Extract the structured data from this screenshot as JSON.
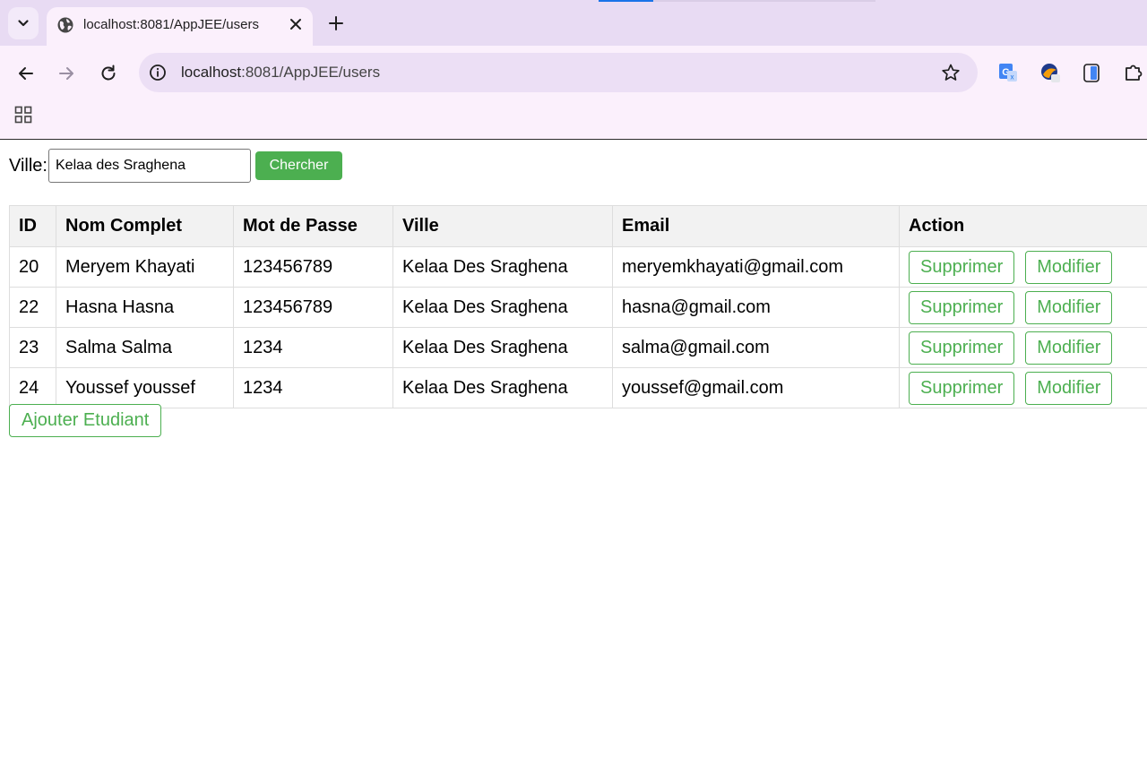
{
  "browser": {
    "tab_title": "localhost:8081/AppJEE/users",
    "url_host": "localhost",
    "url_path": ":8081/AppJEE/users"
  },
  "search": {
    "label": "Ville:",
    "value": "Kelaa des Sraghena",
    "button_label": "Chercher"
  },
  "table": {
    "headers": {
      "id": "ID",
      "nom": "Nom Complet",
      "mdp": "Mot de Passe",
      "ville": "Ville",
      "email": "Email",
      "action": "Action"
    },
    "rows": [
      {
        "id": "20",
        "nom": "Meryem Khayati",
        "mdp": "123456789",
        "ville": "Kelaa Des Sraghena",
        "email": "meryemkhayati@gmail.com",
        "delete_label": "Supprimer",
        "edit_label": "Modifier"
      },
      {
        "id": "22",
        "nom": "Hasna Hasna",
        "mdp": "123456789",
        "ville": "Kelaa Des Sraghena",
        "email": "hasna@gmail.com",
        "delete_label": "Supprimer",
        "edit_label": "Modifier"
      },
      {
        "id": "23",
        "nom": "Salma Salma",
        "mdp": "1234",
        "ville": "Kelaa Des Sraghena",
        "email": "salma@gmail.com",
        "delete_label": "Supprimer",
        "edit_label": "Modifier"
      },
      {
        "id": "24",
        "nom": "Youssef youssef",
        "mdp": "1234",
        "ville": "Kelaa Des Sraghena",
        "email": "youssef@gmail.com",
        "delete_label": "Supprimer",
        "edit_label": "Modifier"
      }
    ]
  },
  "add_button_label": "Ajouter Etudiant",
  "colors": {
    "accent": "#4caf50",
    "chrome_bg": "#fbf0fc",
    "tabstrip_bg": "#e8dbf3",
    "header_bg": "#f2f2f2"
  },
  "icons": {
    "tab_search": "chevron-down-icon",
    "favicon": "globe-icon",
    "tab_close": "close-icon",
    "new_tab": "plus-icon",
    "back": "arrow-left-icon",
    "forward": "arrow-right-icon",
    "reload": "reload-icon",
    "site_info": "info-icon",
    "bookmark": "star-icon",
    "translate": "translate-icon",
    "extension_1": "extension-icon",
    "extension_2": "phone-icon",
    "extensions": "puzzle-icon",
    "apps": "apps-grid-icon"
  }
}
